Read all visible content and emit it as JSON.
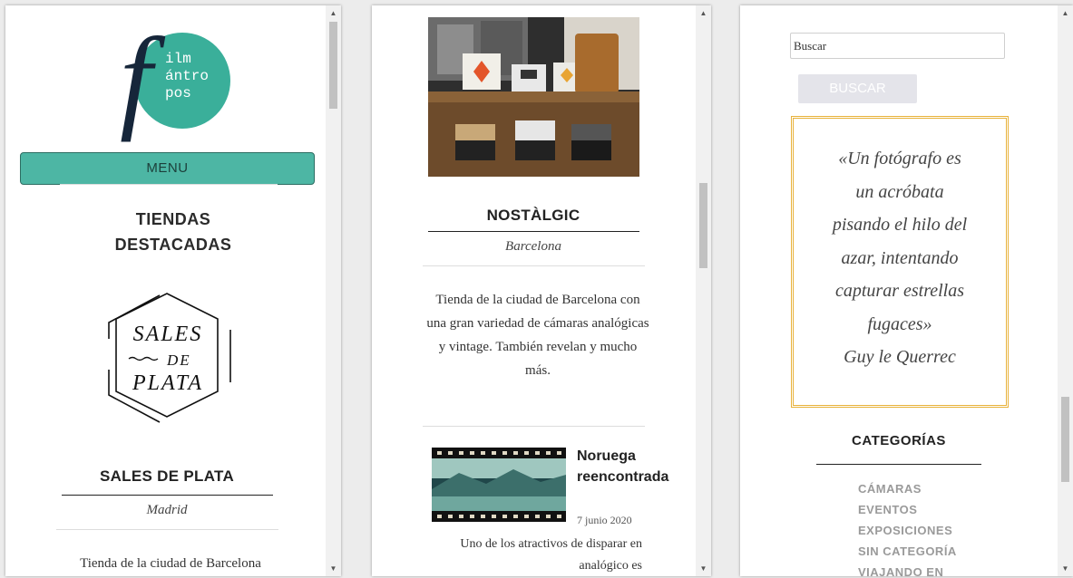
{
  "left_panel": {
    "logo": {
      "letter": "f",
      "text_lines": [
        "ilm",
        "ántro",
        "pos"
      ],
      "colors": {
        "circle": "#3aaf9a",
        "letter": "#16263a"
      }
    },
    "menu_label": "MENU",
    "section_heading_lines": [
      "TIENDAS",
      "DESTACADAS"
    ],
    "shop_logo_lines": [
      "SALES",
      "DE",
      "PLATA"
    ],
    "shop_title": "SALES DE PLATA",
    "shop_city": "Madrid",
    "shop_description": "Tienda de la ciudad de Barcelona"
  },
  "middle_panel": {
    "shop_title": "NOSTÀLGIC",
    "shop_city": "Barcelona",
    "shop_description": "Tienda de la ciudad de Barcelona con una gran variedad de cámaras analógicas y vintage. También revelan y mucho más.",
    "post": {
      "title": "Noruega reencontrada",
      "date": "7 junio 2020",
      "excerpt": "Uno de los atractivos de disparar en analógico es"
    }
  },
  "right_panel": {
    "search": {
      "value": "Buscar",
      "button_label": "BUSCAR"
    },
    "quote": {
      "lines": [
        "«Un fotógrafo es",
        "un acróbata",
        "pisando el hilo del",
        "azar, intentando",
        "capturar estrellas",
        "fugaces»"
      ],
      "author": "Guy le Querrec",
      "border_color": "#e8b23a"
    },
    "categories_heading": "CATEGORÍAS",
    "categories": [
      "CÁMARAS",
      "EVENTOS",
      "EXPOSICIONES",
      "SIN CATEGORÍA",
      "VIAJANDO EN"
    ]
  },
  "icons": {
    "scroll_up": "▲",
    "scroll_down": "▼"
  },
  "scroll_position": {
    "left": 0.04,
    "middle": 0.32,
    "right": 0.72
  }
}
